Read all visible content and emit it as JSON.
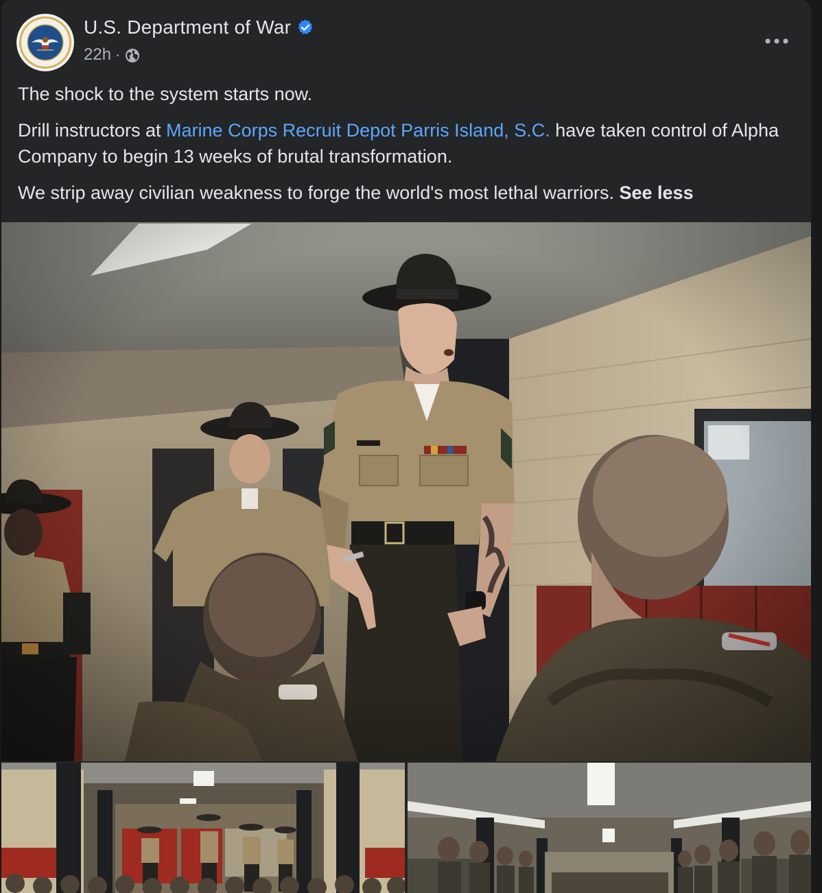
{
  "post": {
    "author_name": "U.S. Department of War",
    "verified_icon": "verified-badge-icon",
    "timestamp": "22h",
    "separator": "·",
    "audience_icon": "globe-icon",
    "more_icon": "more-options-icon",
    "paragraphs": {
      "p1": "The shock to the system starts now.",
      "p2_before": "Drill instructors at ",
      "p2_link": "Marine Corps Recruit Depot Parris Island, S.C.",
      "p2_after": " have taken control of Alpha Company to begin 13 weeks of brutal transformation.",
      "p3": "We strip away civilian weakness to forge the world's most lethal warriors. ",
      "see_less": "See less"
    },
    "images": {
      "main": "photo-drill-instructor-addressing-recruits",
      "thumb_left": "photo-drill-instructors-in-squad-bay",
      "thumb_right": "photo-recruits-in-formation"
    }
  },
  "colors": {
    "card_background": "#242526",
    "page_background": "#18191a",
    "primary_text": "#e4e6eb",
    "secondary_text": "#b0b3b8",
    "link": "#5aa7ff",
    "verified": "#2d88ff"
  }
}
